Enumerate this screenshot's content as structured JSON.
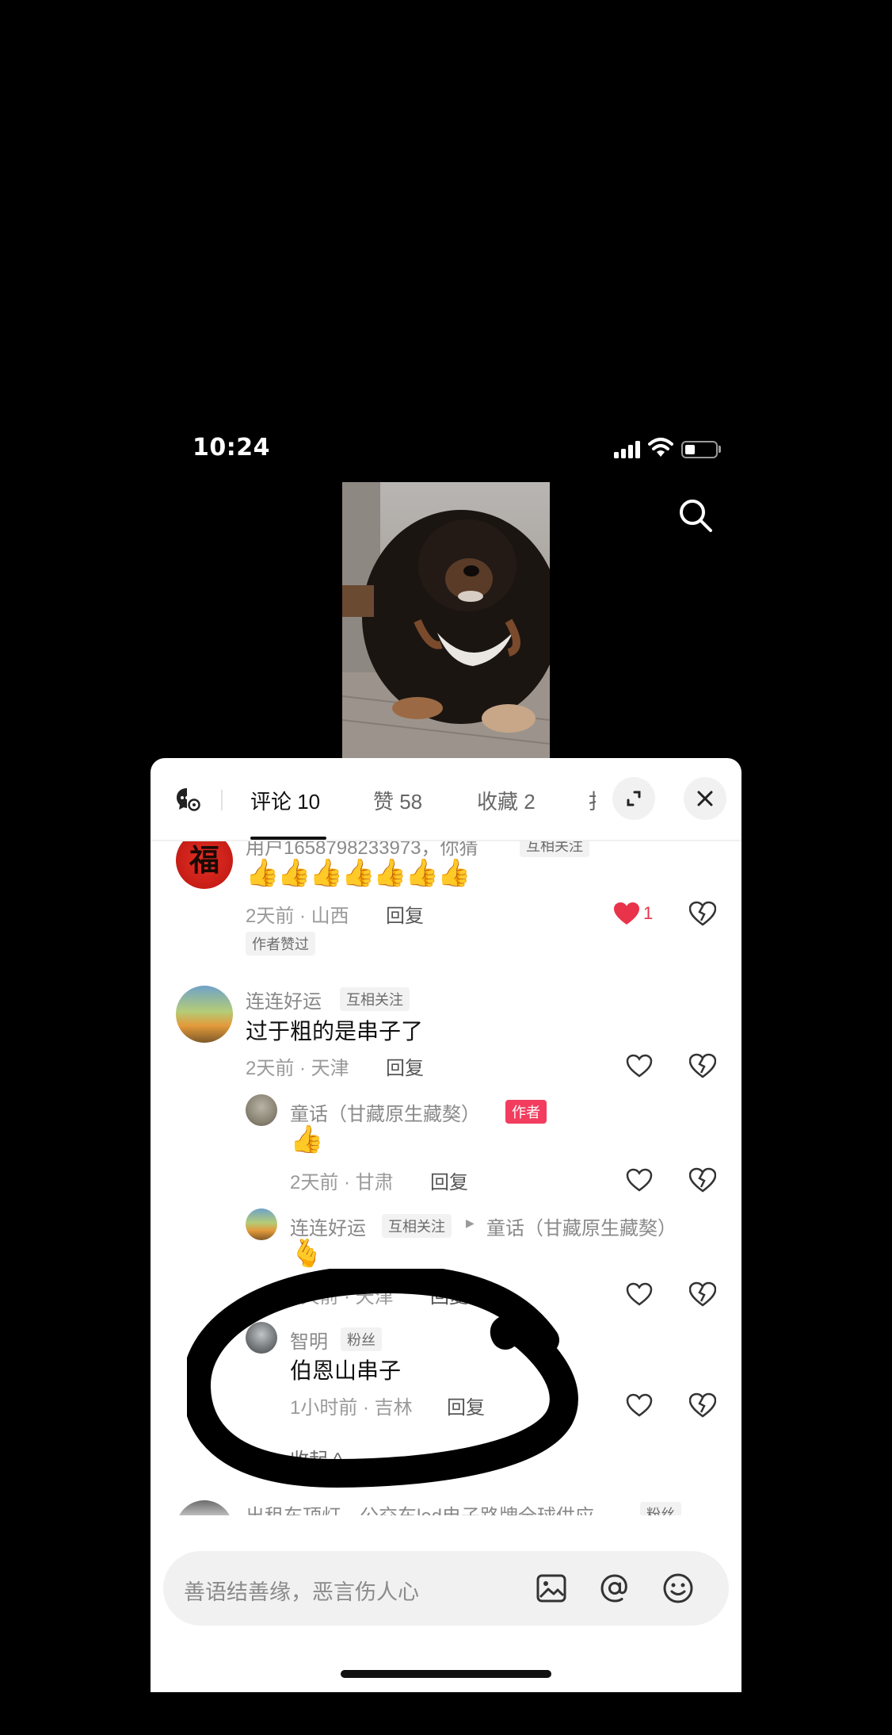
{
  "status_bar": {
    "time": "10:24"
  },
  "tabs": [
    {
      "label": "评论 10",
      "active": true
    },
    {
      "label": "赞 58",
      "active": false
    },
    {
      "label": "收藏 2",
      "active": false
    },
    {
      "label": "扌",
      "active": false
    }
  ],
  "comments": [
    {
      "username": "用户1658798233973，你猜",
      "tag": "互相关注",
      "emoji": "👍👍👍👍👍👍👍",
      "time_location": "2天前 · 山西",
      "reply_label": "回复",
      "liked": true,
      "likes": "1",
      "author_liked_badge": "作者赞过"
    },
    {
      "username": "连连好运",
      "tag": "互相关注",
      "text": "过于粗的是串子了",
      "time_location": "2天前 · 天津",
      "reply_label": "回复",
      "replies": [
        {
          "username": "童话（甘藏原生藏獒）",
          "tag": "作者",
          "emoji": "👍",
          "time_location": "2天前 · 甘肃",
          "reply_label": "回复"
        },
        {
          "username": "连连好运",
          "tag": "互相关注",
          "reply_to": "童话（甘藏原生藏獒）",
          "emoji": "🫰",
          "time_location": "2天前 · 天津",
          "reply_label": "回复"
        },
        {
          "username": "智明",
          "tag": "粉丝",
          "text": "伯恩山串子",
          "time_location": "1小时前 · 吉林",
          "reply_label": "回复"
        }
      ],
      "collapse_label": "收起 ^"
    },
    {
      "username": "出租车顶灯，公交车led电子路牌全球供应",
      "tag": "粉丝",
      "emoji": "👍👍👍"
    }
  ],
  "input": {
    "placeholder": "善语结善缘，恶言伤人心"
  },
  "colors": {
    "like_red": "#e8334a",
    "author_tag": "#f23d5f"
  },
  "icons": [
    "search-icon",
    "chat-settings-icon",
    "expand-icon",
    "close-icon",
    "heart-icon",
    "broken-heart-icon",
    "image-icon",
    "at-icon",
    "emoji-icon"
  ]
}
